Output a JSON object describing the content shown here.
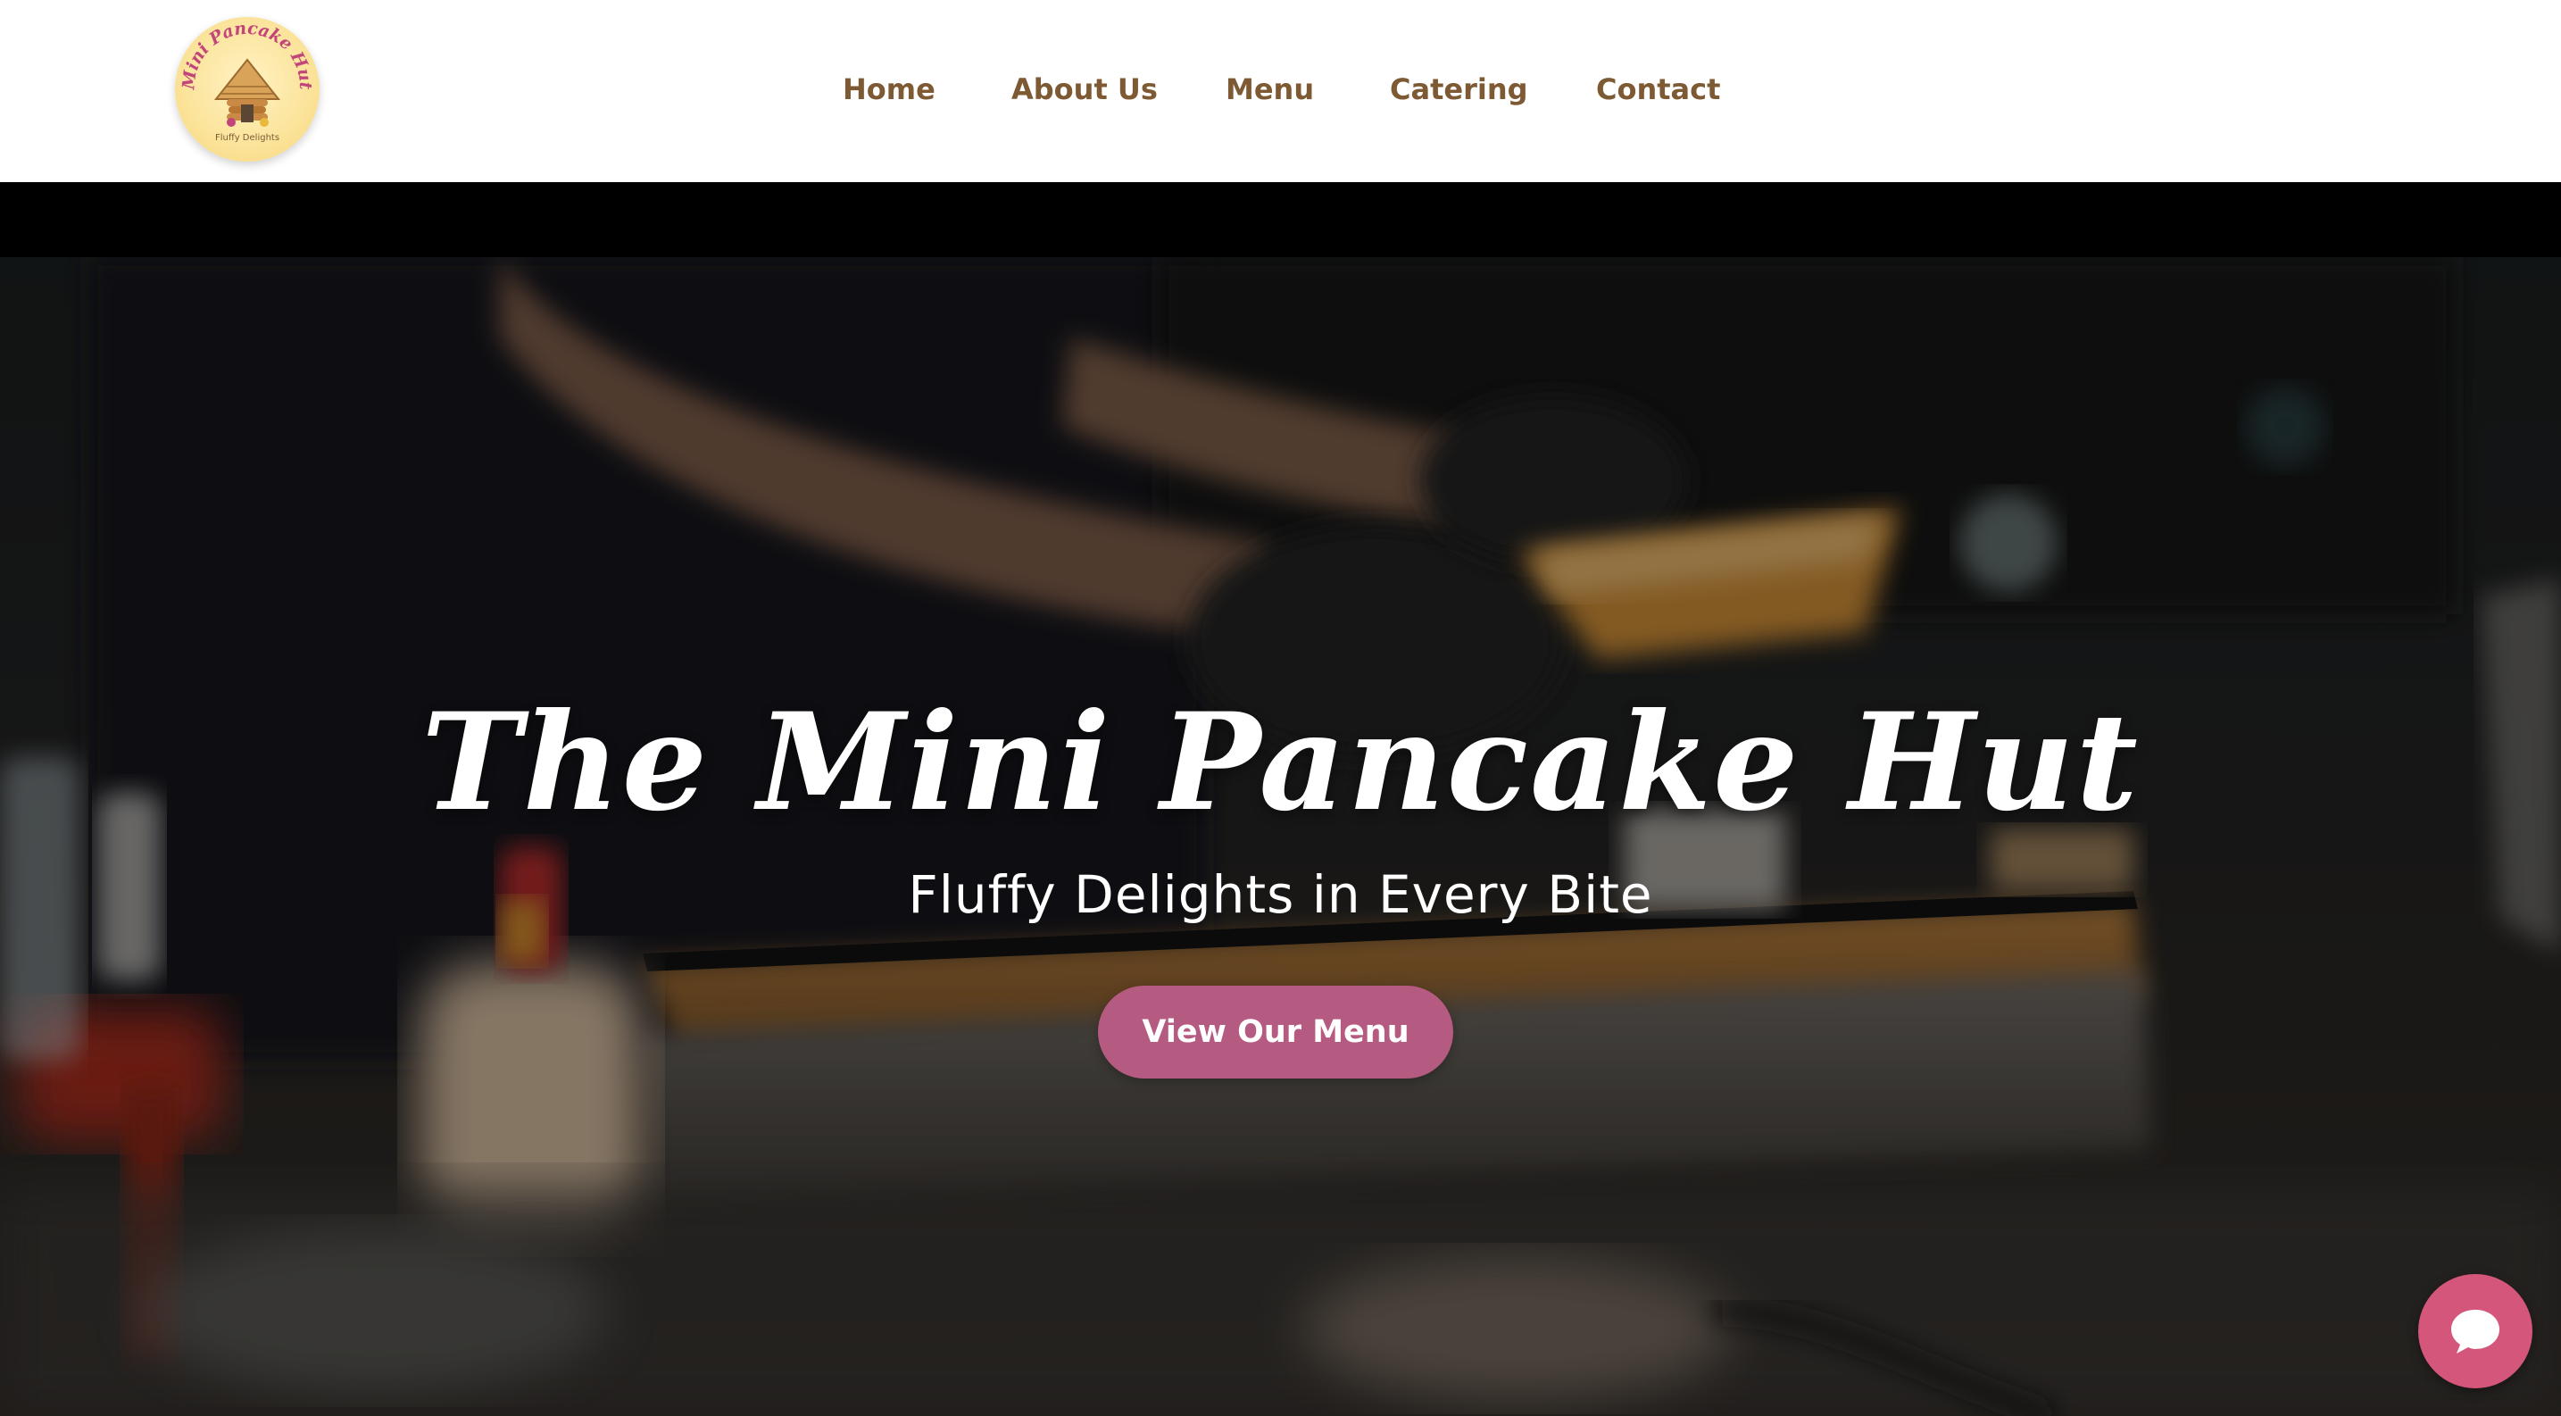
{
  "logo": {
    "top_text": "Mini Pancake Hut",
    "bottom_text": "Fluffy Delights"
  },
  "nav": {
    "items": [
      {
        "label": "Home"
      },
      {
        "label": "About Us"
      },
      {
        "label": "Menu"
      },
      {
        "label": "Catering"
      },
      {
        "label": "Contact"
      }
    ]
  },
  "hero": {
    "title": "The Mini Pancake Hut",
    "subtitle": "Fluffy Delights in Every Bite",
    "cta_label": "View Our Menu"
  },
  "chat": {
    "icon": "chat-bubble-icon"
  },
  "colors": {
    "nav_text": "#7d5a33",
    "cta_background": "#b55a80",
    "chat_background": "#d4567a",
    "logo_background": "#fbe39a"
  }
}
